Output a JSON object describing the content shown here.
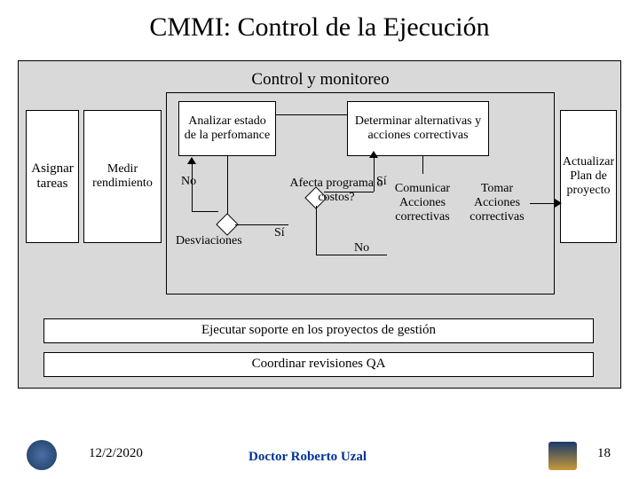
{
  "title": "CMMI: Control de la Ejecución",
  "monitor_title": "Control y monitoreo",
  "boxes": {
    "asignar": "Asignar tareas",
    "medir": "Medir rendimiento",
    "analizar": "Analizar estado de la perfomance",
    "determinar": "Determinar alternativas y acciones correctivas",
    "comunicar": "Comunicar Acciones correctivas",
    "tomar": "Tomar Acciones correctivas",
    "actualizar": "Actualizar Plan de proyecto"
  },
  "labels": {
    "no_loop": "No",
    "desviaciones": "Desviaciones",
    "si1": "Sí",
    "afecta": "Afecta programa o costos?",
    "si2": "Sí",
    "no2": "No"
  },
  "bars": {
    "ejecutar": "Ejecutar soporte en los proyectos de gestión",
    "coordinar": "Coordinar revisiones QA"
  },
  "footer": {
    "date": "12/2/2020",
    "author": "Doctor Roberto Uzal",
    "page": "18"
  },
  "chart_data": {
    "type": "diagram",
    "title": "CMMI: Control de la Ejecución",
    "container": "Control y monitoreo",
    "nodes": [
      {
        "id": "asignar",
        "label": "Asignar tareas",
        "kind": "process"
      },
      {
        "id": "medir",
        "label": "Medir rendimiento",
        "kind": "process"
      },
      {
        "id": "analizar",
        "label": "Analizar estado de la perfomance",
        "kind": "process"
      },
      {
        "id": "desviaciones",
        "label": "Desviaciones",
        "kind": "decision"
      },
      {
        "id": "afecta",
        "label": "Afecta programa o costos?",
        "kind": "decision"
      },
      {
        "id": "determinar",
        "label": "Determinar alternativas y acciones correctivas",
        "kind": "process"
      },
      {
        "id": "comunicar",
        "label": "Comunicar Acciones correctivas",
        "kind": "process"
      },
      {
        "id": "tomar",
        "label": "Tomar Acciones correctivas",
        "kind": "process"
      },
      {
        "id": "actualizar",
        "label": "Actualizar Plan de proyecto",
        "kind": "process"
      }
    ],
    "edges": [
      {
        "from": "analizar",
        "to": "desviaciones"
      },
      {
        "from": "desviaciones",
        "to": "analizar",
        "label": "No"
      },
      {
        "from": "desviaciones",
        "to": "afecta",
        "label": "Sí"
      },
      {
        "from": "afecta",
        "to": "determinar",
        "label": "Sí"
      },
      {
        "from": "afecta",
        "to": "comunicar",
        "label": "No"
      },
      {
        "from": "determinar",
        "to": "comunicar"
      },
      {
        "from": "comunicar",
        "to": "tomar"
      },
      {
        "from": "tomar",
        "to": "actualizar"
      }
    ],
    "support_bars": [
      "Ejecutar soporte en los proyectos de gestión",
      "Coordinar revisiones QA"
    ]
  }
}
